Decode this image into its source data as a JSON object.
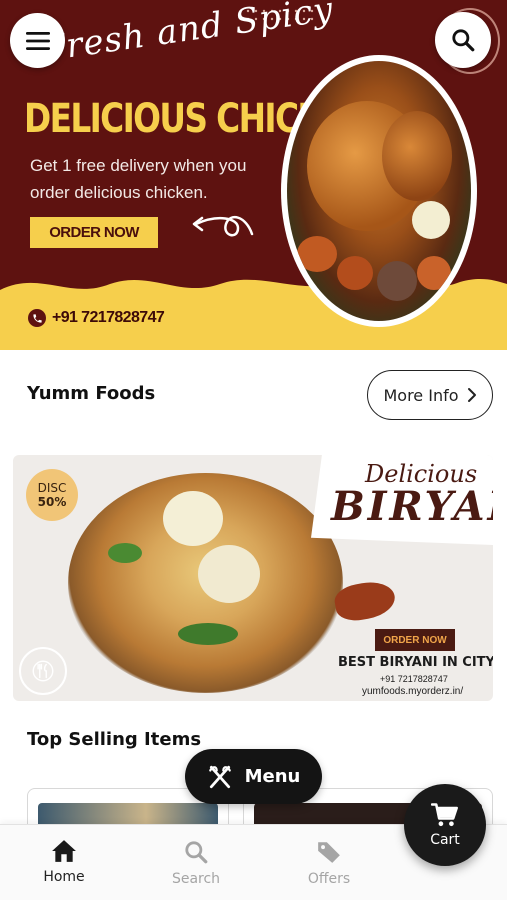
{
  "hero": {
    "script_text": "Fresh and Spicy",
    "title": "DELICIOUS CHICKEN",
    "subtitle": "Get 1 free delivery when you order delicious chicken.",
    "order_button": "ORDER NOW",
    "phone": "+91 7217828747",
    "colors": {
      "background": "#5e1210",
      "accent": "#f6cf4c"
    }
  },
  "header": {
    "menu_icon": "hamburger-icon",
    "search_icon": "search-icon"
  },
  "store": {
    "name": "Yumm Foods",
    "more_info_label": "More Info",
    "more_info_icon": "chevron-right-icon"
  },
  "promo": {
    "disc_label": "DISC",
    "disc_value": "50%",
    "script_text": "Delicious",
    "title": "BIRYANI",
    "order_button": "ORDER NOW",
    "tagline": "BEST BIRYANI IN CITY",
    "phone": "+91 7217828747",
    "url": "yumfoods.myorderz.in/"
  },
  "top_selling": {
    "title": "Top Selling Items"
  },
  "menu_pill": {
    "label": "Menu",
    "icon": "fork-knife-icon"
  },
  "cart": {
    "label": "Cart",
    "icon": "cart-icon"
  },
  "bottom_nav": {
    "items": [
      {
        "label": "Home",
        "icon": "home-icon",
        "active": true
      },
      {
        "label": "Search",
        "icon": "search-icon",
        "active": false
      },
      {
        "label": "Offers",
        "icon": "tag-icon",
        "active": false
      }
    ]
  }
}
